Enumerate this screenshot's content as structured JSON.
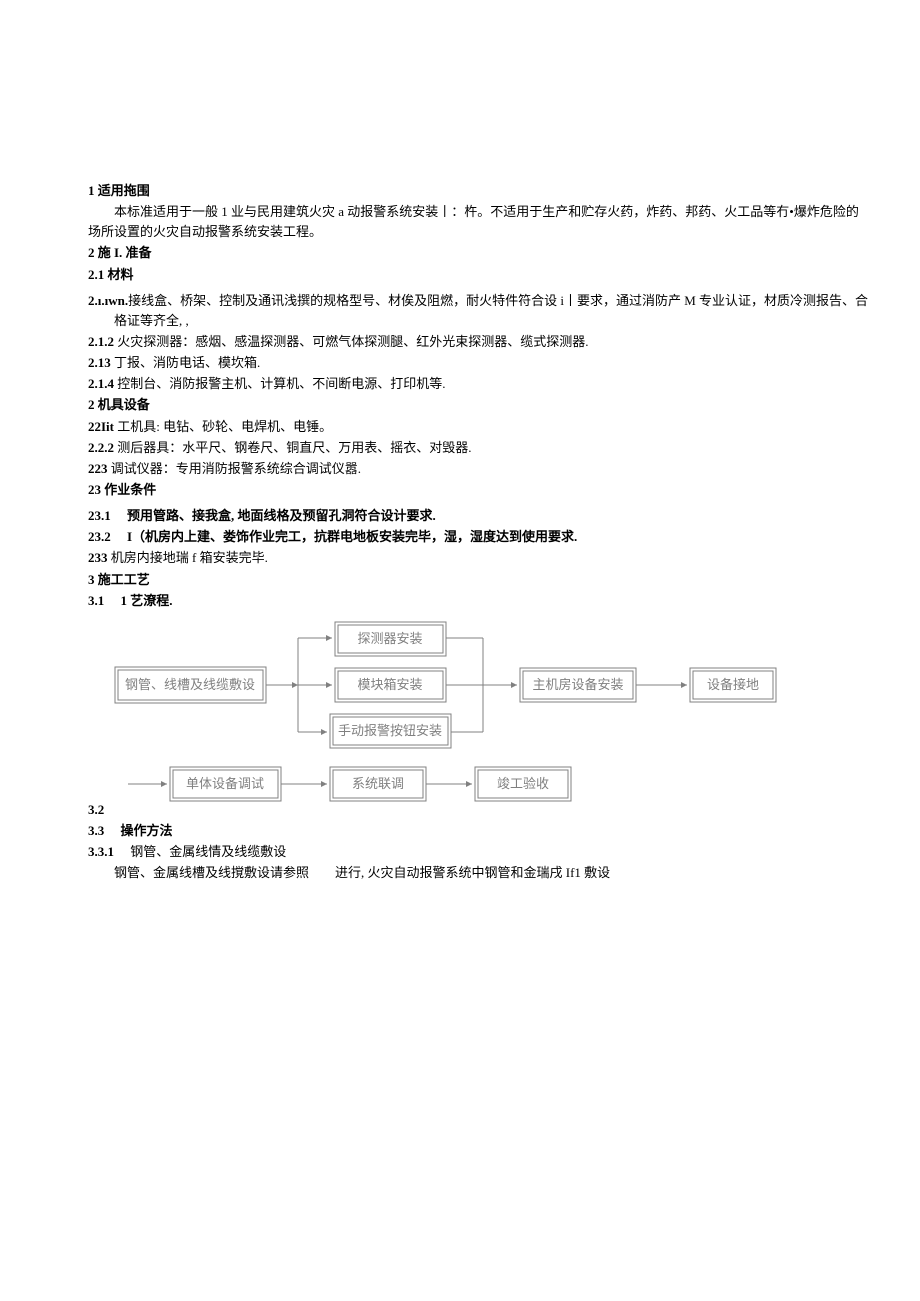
{
  "sec1_h": "1 适用拖围",
  "sec1_p": "本标准适用于一般 1 业与民用建筑火灾 a 动报警系统安装丨：杵。不适用于生产和贮存火药，炸药、邦药、火工品等冇•爆炸危险的场所设置的火灾自动报警系统安装工程。",
  "sec2_h": "2 施 I. 准备",
  "sec21_h": "2.1 材料",
  "p211a": "2.ı.ıwn.",
  "p211b": "接线盒、桥架、控制及通讯浅撰的规格型号、材俟及阻燃，耐火特件符合设 i丨要求，通过消防产 M 专业认证，材质冷测报告、合格证等齐全, ,",
  "p212a": "2.1.2",
  "p212b": " 火灾探测器：感烟、感温探测器、可燃气体探测腿、红外光束探测器、缆式探测器.",
  "p213a": "2.13",
  "p213b": " 丁报、消防电话、模坎箱.",
  "p214a": "2.1.4",
  "p214b": " 控制台、消防报警主机、计算机、不间断电源、打印机等.",
  "sec22_h": "2 机具设备",
  "p221a": "22Iit",
  "p221b": " 工机具: 电钻、砂轮、电焊机、电锤。",
  "p222a": "2.2.2",
  "p222b": " 测后器具：水平尺、钢卷尺、铜直尺、万用表、摇衣、对毁器.",
  "p223a": "223",
  "p223b": " 调试仪器：专用消防报警系统综合调试仪嚣.",
  "sec23_h": "23 作业条件",
  "p231a": "23.1  预用管路、接我盒, 地面线格及预留孔洞符合设计要求.",
  "p232a": "23.2  I（机房内上建、娄饰作业完工，抗群电地板安装完毕，湿，湿度达到使用要求.",
  "p233a": "233",
  "p233b": " 机房内接地瑞 f 箱安装完毕.",
  "sec3_h": "3 施工工艺",
  "p31": "3.1  1 艺潦程.",
  "p32": "3.2",
  "p33": "3.3  操作方法",
  "p331a": "3.3.1  ",
  "p331b": "钢管、金属线情及线缆敷设",
  "p331c": "钢管、金属线槽及线撹敷设请参照  进行, 火灾自动报警系统中钢管和金瑞戌 If1 敷设",
  "flow": {
    "a": "钢管、线槽及线缆敷设",
    "b1": "探测器安装",
    "b2": "模块箱安装",
    "b3": "手动报警按钮安装",
    "c": "主机房设备安装",
    "d": "设备接地",
    "e": "单体设备调试",
    "f": "系统联调",
    "g": "竣工验收"
  }
}
